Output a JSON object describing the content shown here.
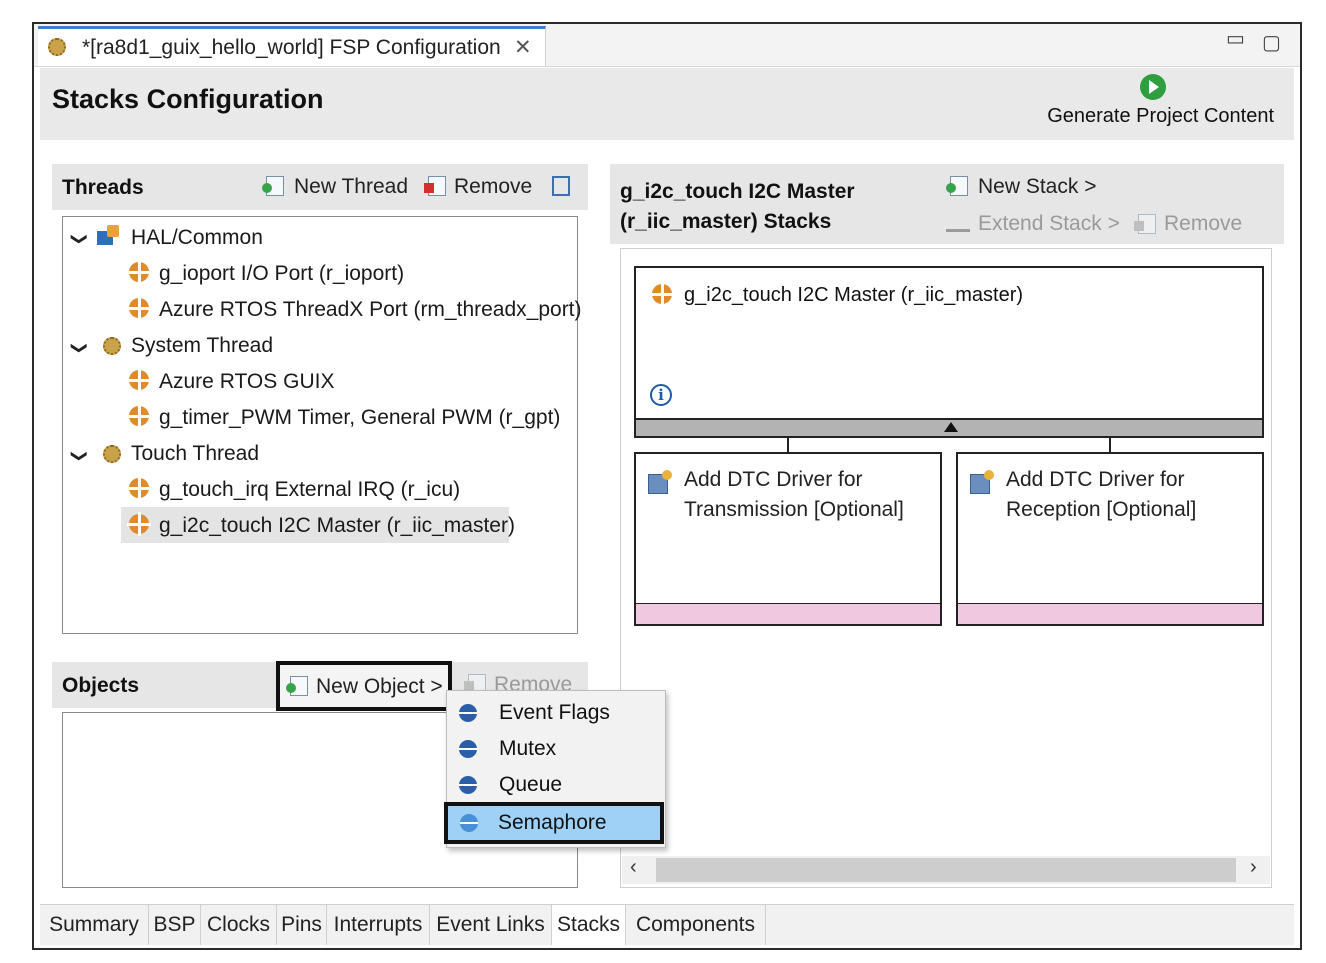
{
  "editor_tab": {
    "title": "*[ra8d1_guix_hello_world] FSP Configuration",
    "close": "✕"
  },
  "window_controls": {
    "minimize": "▭",
    "maximize": "▢"
  },
  "header": {
    "title": "Stacks Configuration",
    "generate_label": "Generate Project Content"
  },
  "threads_panel": {
    "title": "Threads",
    "new_thread": "New Thread",
    "remove": "Remove",
    "items": [
      {
        "label": "HAL/Common"
      },
      {
        "label": "g_ioport I/O Port (r_ioport)"
      },
      {
        "label": "Azure RTOS ThreadX Port (rm_threadx_port)"
      },
      {
        "label": "System Thread"
      },
      {
        "label": "Azure RTOS GUIX"
      },
      {
        "label": "g_timer_PWM Timer, General PWM (r_gpt)"
      },
      {
        "label": "Touch Thread"
      },
      {
        "label": "g_touch_irq External IRQ (r_icu)"
      },
      {
        "label": "g_i2c_touch I2C Master (r_iic_master)"
      }
    ]
  },
  "stacks_panel": {
    "title_line1": "g_i2c_touch I2C Master",
    "title_line2": "(r_iic_master) Stacks",
    "new_stack": "New Stack >",
    "extend_stack": "Extend Stack >",
    "remove": "Remove",
    "module": "g_i2c_touch I2C Master (r_iic_master)",
    "dtc_tx_line1": "Add DTC Driver for",
    "dtc_tx_line2": "Transmission [Optional]",
    "dtc_rx_line1": "Add DTC Driver for",
    "dtc_rx_line2": "Reception [Optional]"
  },
  "objects_panel": {
    "title": "Objects",
    "new_object": "New Object >",
    "remove": "Remove",
    "menu": [
      "Event Flags",
      "Mutex",
      "Queue",
      "Semaphore"
    ]
  },
  "bottom_tabs": [
    "Summary",
    "BSP",
    "Clocks",
    "Pins",
    "Interrupts",
    "Event Links",
    "Stacks",
    "Components"
  ],
  "active_bottom_tab": "Stacks"
}
